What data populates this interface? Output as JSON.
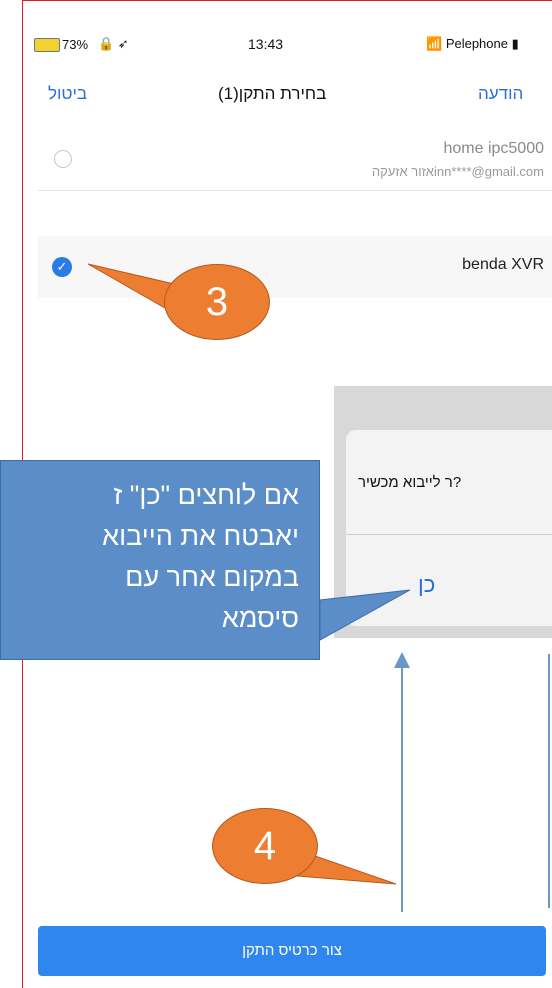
{
  "status_bar": {
    "battery": "73%",
    "icons": "🔒 ➶",
    "time": "13:43",
    "carrier": "Pelephone",
    "wifi_icon": "wifi-icon"
  },
  "nav": {
    "cancel": "ביטול",
    "title": "בחירת התקן(1)",
    "notify": "הודעה"
  },
  "devices": [
    {
      "name": "home ipc5000",
      "subtitle": "אזור אזעקהinn****@gmail.com",
      "selected": false
    },
    {
      "name": "benda XVR",
      "selected": true
    }
  ],
  "dialog": {
    "question": "ר לייבוא מכשיר?",
    "yes": "כן"
  },
  "callout": {
    "text": "אם לוחצים \"כן\" ז\nיאבטח את הייבוא\nבמקום אחר עם\nסיסמא"
  },
  "badges": {
    "step3": "3",
    "step4": "4"
  },
  "create_button": "צור כרטיס התקן",
  "colors": {
    "accent": "#2a6fd6",
    "button": "#2f86ee",
    "badge": "#ed7d31",
    "callout": "#5b8ec8",
    "frame": "#e02020"
  }
}
